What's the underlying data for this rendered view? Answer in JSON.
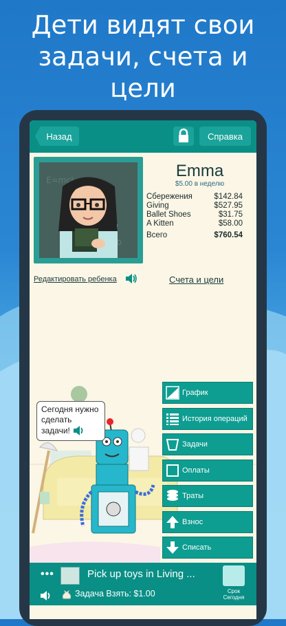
{
  "headline": {
    "line1": "Дети видят свои",
    "line2": "задачи, счета и",
    "line3": "цели"
  },
  "topbar": {
    "back_label": "Назад",
    "lock_icon": "lock-icon",
    "help_label": "Справка"
  },
  "child": {
    "name": "Emma",
    "allowance": "$5.00 в неделю",
    "accounts": [
      {
        "name": "Сбережения",
        "amount": "$142.84"
      },
      {
        "name": "Giving",
        "amount": "$527.95"
      },
      {
        "name": "Ballet Shoes",
        "amount": "$31.75"
      },
      {
        "name": "A Kitten",
        "amount": "$58.00"
      }
    ],
    "total_label": "Всего",
    "total_amount": "$760.54"
  },
  "links": {
    "edit_child": "Редактировать ребенка",
    "accounts_goals": "Счета и цели"
  },
  "speech": {
    "text_line1": "Сегодня нужно",
    "text_line2": "сделать",
    "text_line3": "задачи!"
  },
  "side_menu": [
    {
      "label": "График",
      "icon": "chart-icon"
    },
    {
      "label": "История операций",
      "icon": "list-icon"
    },
    {
      "label": "Задачи",
      "icon": "bucket-icon"
    },
    {
      "label": "Оплаты",
      "icon": "checkbox-icon"
    },
    {
      "label": "Траты",
      "icon": "coins-icon"
    },
    {
      "label": "Взнос",
      "icon": "arrow-up-icon"
    },
    {
      "label": "Списать",
      "icon": "arrow-down-icon"
    }
  ],
  "bottom": {
    "dots": "•••",
    "task": "Pick up toys in Living ...",
    "due_line1": "Срок",
    "due_line2": "Сегодня",
    "reward": "Задача Взять: $1.00"
  },
  "colors": {
    "teal": "#0a8f86",
    "button_teal": "#1aa39a",
    "screen_bg": "#fbf6e6",
    "phone_frame": "#253746",
    "sky_top": "#1f78c8"
  }
}
